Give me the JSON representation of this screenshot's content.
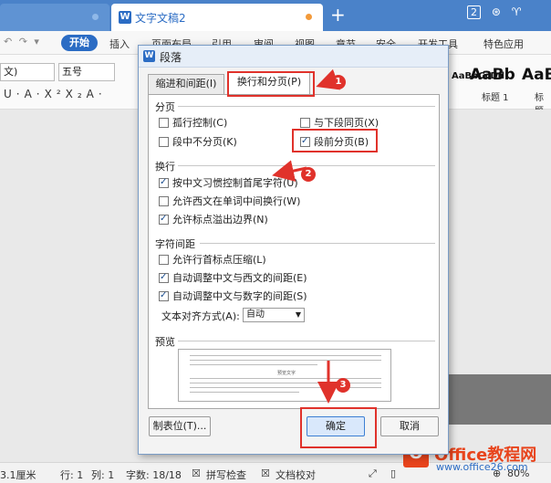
{
  "app": {
    "doc_tab_title": "文字文稿2",
    "wps_logo_letter": "W",
    "new_tab_label": "+",
    "window_count": "2"
  },
  "menubar": {
    "start_label": "开始",
    "items": [
      "插入",
      "页面布局",
      "引用",
      "审阅",
      "视图",
      "章节",
      "安全",
      "开发工具",
      "特色应用"
    ]
  },
  "ribbon": {
    "font_name": "文)",
    "font_size": "五号",
    "style_sample_1": "AaBbCcDd",
    "style_sample_2": "AaBb",
    "style_sample_3": "AaB",
    "style_label_1": "标题 1",
    "style_label_2": "标题"
  },
  "dialog": {
    "title": "段落",
    "tab_indent": "缩进和间距(I)",
    "tab_linebreak": "换行和分页(P)",
    "section_pagination": "分页",
    "opt_widow": "孤行控制(C)",
    "opt_keep_next": "与下段同页(X)",
    "opt_keep_together": "段中不分页(K)",
    "opt_page_break_before": "段前分页(B)",
    "section_linebreak": "换行",
    "opt_cn_rules": "按中文习惯控制首尾字符(U)",
    "opt_word_wrap": "允许西文在单词中间换行(W)",
    "opt_hanging_punct": "允许标点溢出边界(N)",
    "section_spacing": "字符间距",
    "opt_compress_punct": "允许行首标点压缩(L)",
    "opt_auto_cn_en": "自动调整中文与西文的间距(E)",
    "opt_auto_cn_num": "自动调整中文与数字的间距(S)",
    "text_align_label": "文本对齐方式(A):",
    "text_align_value": "自动",
    "section_preview": "预览",
    "preview_sample": "预览文字",
    "btn_tabs": "制表位(T)...",
    "btn_ok": "确定",
    "btn_cancel": "取消"
  },
  "checkbox_states": {
    "widow": false,
    "keep_next": false,
    "keep_together": false,
    "page_break_before": true,
    "cn_rules": true,
    "word_wrap": false,
    "hanging_punct": true,
    "compress_punct": false,
    "auto_cn_en": true,
    "auto_cn_num": true
  },
  "annotations": {
    "step1": "1",
    "step2": "2",
    "step3": "3"
  },
  "statusbar": {
    "position": "3.1厘米",
    "row": "行: 1",
    "col": "列: 1",
    "wordcount": "字数: 18/18",
    "spellcheck": "拼写检查",
    "doc_proof": "文档校对",
    "zoom": "80%"
  },
  "watermark": {
    "brand": "Office教程网",
    "url": "www.office26.com",
    "logo_letter": "O"
  },
  "colors": {
    "accent": "#2b6cc4",
    "annotation": "#e0322b",
    "brand": "#e8441c"
  }
}
